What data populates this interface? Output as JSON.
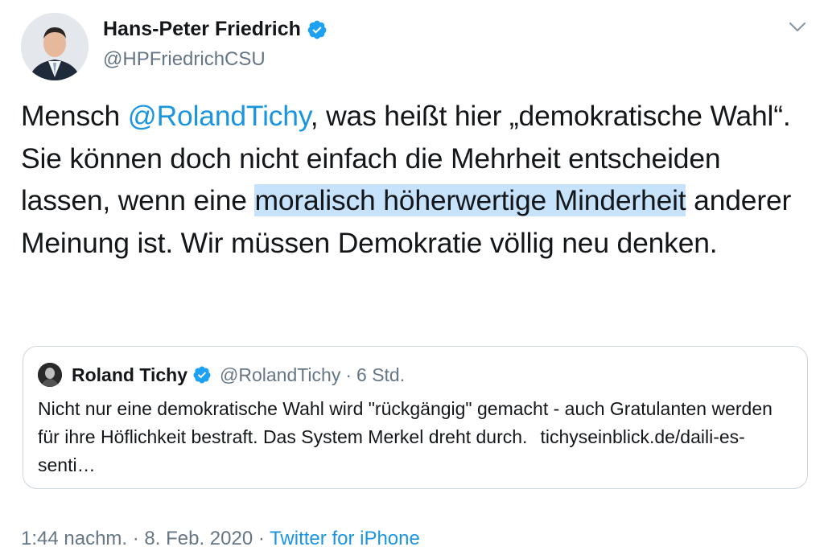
{
  "author": {
    "name": "Hans-Peter Friedrich",
    "handle": "@HPFriedrichCSU",
    "verified": true
  },
  "tweet": {
    "text_1": "Mensch ",
    "mention": "@RolandTichy",
    "text_2": ", was heißt hier „demokratische Wahl“. Sie können doch nicht einfach die Mehrheit entscheiden lassen, wenn eine ",
    "highlight": "moralisch höherwertige Minderheit",
    "text_3": " anderer Meinung ist. Wir müssen Demokratie völlig neu denken."
  },
  "quoted": {
    "name": "Roland Tichy",
    "handle": "@RolandTichy",
    "separator": "·",
    "time": "6 Std.",
    "text": "Nicht nur eine demokratische Wahl wird \"rückgängig\" gemacht - auch Gratulanten werden für ihre Höflichkeit bestraft. Das System Merkel dreht durch.",
    "link": "tichyseinblick.de/daili-es-senti…",
    "verified": true
  },
  "meta": {
    "time": "1:44 nachm.",
    "sep1": " · ",
    "date": "8. Feb. 2020",
    "sep2": " · ",
    "source": "Twitter for iPhone"
  },
  "colors": {
    "link": "#1b95e0",
    "secondary": "#657786",
    "highlight": "#c7e2fb",
    "border": "#ccd6dd"
  },
  "icons": {
    "verified": "verified-badge-icon",
    "menu": "chevron-down-icon"
  }
}
